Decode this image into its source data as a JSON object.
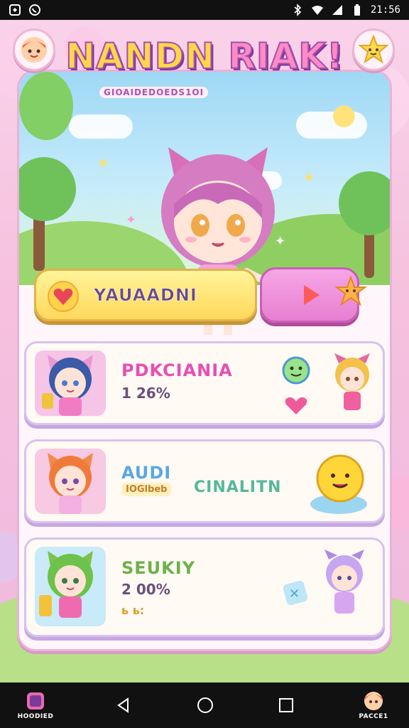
{
  "status_bar": {
    "left_icons": [
      "notification-icon",
      "whatsapp-icon"
    ],
    "right_icons": [
      "bluetooth-icon",
      "wifi-icon",
      "signal-icon",
      "battery-icon"
    ],
    "time": "21:56"
  },
  "app": {
    "title_part1": "NANDN",
    "title_part2": "RIAK!",
    "subtitle": "GIOAIDEDOEDS1OI"
  },
  "hero": {
    "main_button_label": "YAUAADNI",
    "play_button_icon": "play-icon",
    "heart_icon": "heart-icon"
  },
  "cards": [
    {
      "name": "PDKCIANIA",
      "value": "1 26%",
      "name_color": "#e84fb2"
    },
    {
      "name": "AUDI",
      "sub": "IOGlbeb",
      "tag": "CINALITN",
      "name_color": "#5aa8e0"
    },
    {
      "name": "SEUKIY",
      "value": "2 00%",
      "extra": "ь ь:",
      "name_color": "#6fb04a"
    }
  ],
  "nav": {
    "left_label": "HOODIED",
    "right_label": "PACCE1",
    "keys": [
      "back-icon",
      "home-icon",
      "recents-icon"
    ]
  },
  "colors": {
    "accent_pink": "#e77fd2",
    "accent_yellow": "#ffd85a",
    "card_border": "#d8c2ee"
  }
}
